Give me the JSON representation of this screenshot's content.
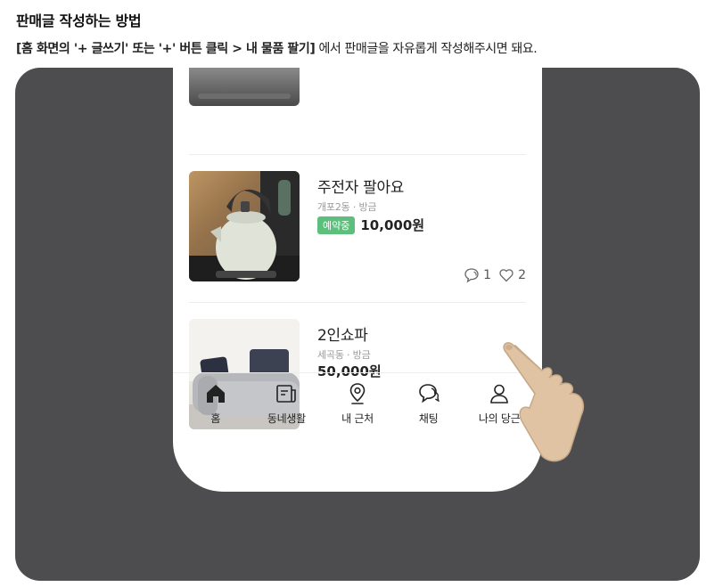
{
  "header": {
    "title": "판매글 작성하는 방법",
    "instruction_bold": "[홈 화면의 '+ 글쓰기' 또는 '+' 버튼 클릭 > 내 물품 팔기]",
    "instruction_rest": " 에서 판매글을 자유롭게 작성해주시면 돼요."
  },
  "listings": [
    {
      "title": "주전자 팔아요",
      "meta": "개포2동 · 방금",
      "badge": "예약중",
      "price": "10,000원",
      "chat_count": "1",
      "like_count": "2"
    },
    {
      "title": "2인쇼파",
      "meta": "세곡동 · 방금",
      "price": "50,000원"
    }
  ],
  "tabs": [
    {
      "label": "홈",
      "icon": "home-icon"
    },
    {
      "label": "동네생활",
      "icon": "news-icon"
    },
    {
      "label": "내 근처",
      "icon": "location-pin-icon"
    },
    {
      "label": "채팅",
      "icon": "chat-icon"
    },
    {
      "label": "나의 당근",
      "icon": "person-icon"
    }
  ],
  "colors": {
    "accent": "#e97f43",
    "badge": "#5cbf7c",
    "panel": "#4d4d4f"
  }
}
